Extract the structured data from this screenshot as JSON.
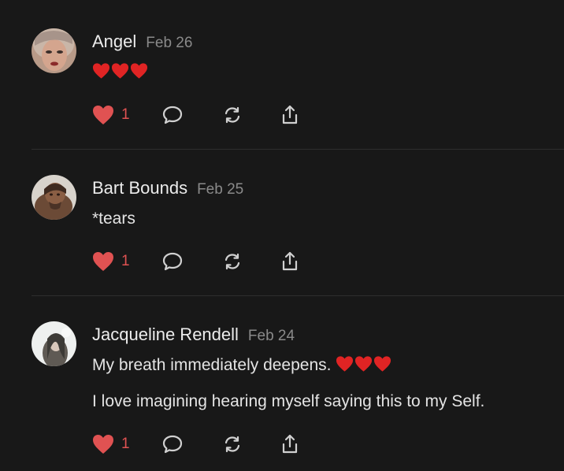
{
  "comments": [
    {
      "author": "Angel",
      "date": "Feb 26",
      "lines": [],
      "hearts": 3,
      "likes": "1",
      "avatar": "avatar-angel"
    },
    {
      "author": "Bart Bounds",
      "date": "Feb 25",
      "lines": [
        "*tears"
      ],
      "hearts": 0,
      "likes": "1",
      "avatar": "avatar-bart"
    },
    {
      "author": "Jacqueline Rendell",
      "date": "Feb 24",
      "lines": [
        "My breath immediately deepens.",
        "I love imagining hearing myself saying this to my Self."
      ],
      "hearts": 3,
      "likes": "1",
      "avatar": "avatar-jacqueline"
    }
  ],
  "icons": [
    "heart-icon",
    "comment-icon",
    "restack-icon",
    "share-icon"
  ],
  "colors": {
    "background": "#181818",
    "like": "#e05252",
    "emoji_heart": "#e02424"
  }
}
